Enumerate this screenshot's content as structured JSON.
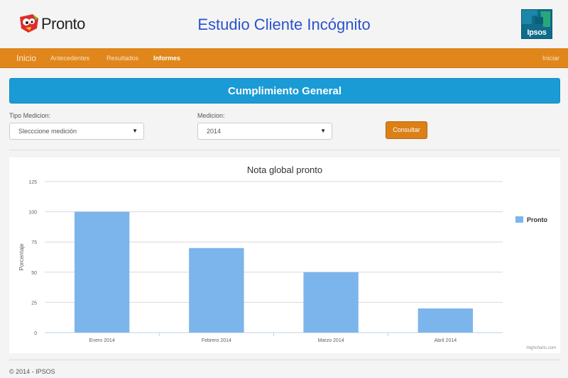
{
  "header": {
    "logo_text": "Pronto",
    "title": "Estudio Cliente Incógnito",
    "brand_logo_text": "Ipsos"
  },
  "nav": {
    "brand": "Inicio",
    "items": [
      "Antecedentes",
      "Resultados",
      "Informes"
    ],
    "active": "Informes",
    "right": "Iniciar"
  },
  "banner": {
    "title": "Cumplimiento General"
  },
  "form": {
    "tipo_label": "Tipo Medicion:",
    "tipo_value": "Slecccione medición",
    "medicion_label": "Medicion:",
    "medicion_value": "2014",
    "button": "Consultar"
  },
  "chart_data": {
    "type": "bar",
    "title": "Nota global pronto",
    "ylabel": "Porcentaje",
    "xlabel": "",
    "categories": [
      "Enero 2014",
      "Febrero 2014",
      "Marzo 2014",
      "Abril 2014"
    ],
    "series": [
      {
        "name": "Pronto",
        "values": [
          100,
          70,
          50,
          20
        ],
        "color": "#7cb5ec"
      }
    ],
    "ylim": [
      0,
      125
    ],
    "yticks": [
      0,
      25,
      50,
      75,
      100,
      125
    ],
    "grid": true,
    "legend": "right",
    "credits": "Highcharts.com"
  },
  "footer": {
    "text": "© 2014 - IPSOS"
  },
  "colors": {
    "nav": "#e0861b",
    "banner": "#1a9bd6",
    "title": "#2a52cc",
    "bar": "#7cb5ec"
  }
}
